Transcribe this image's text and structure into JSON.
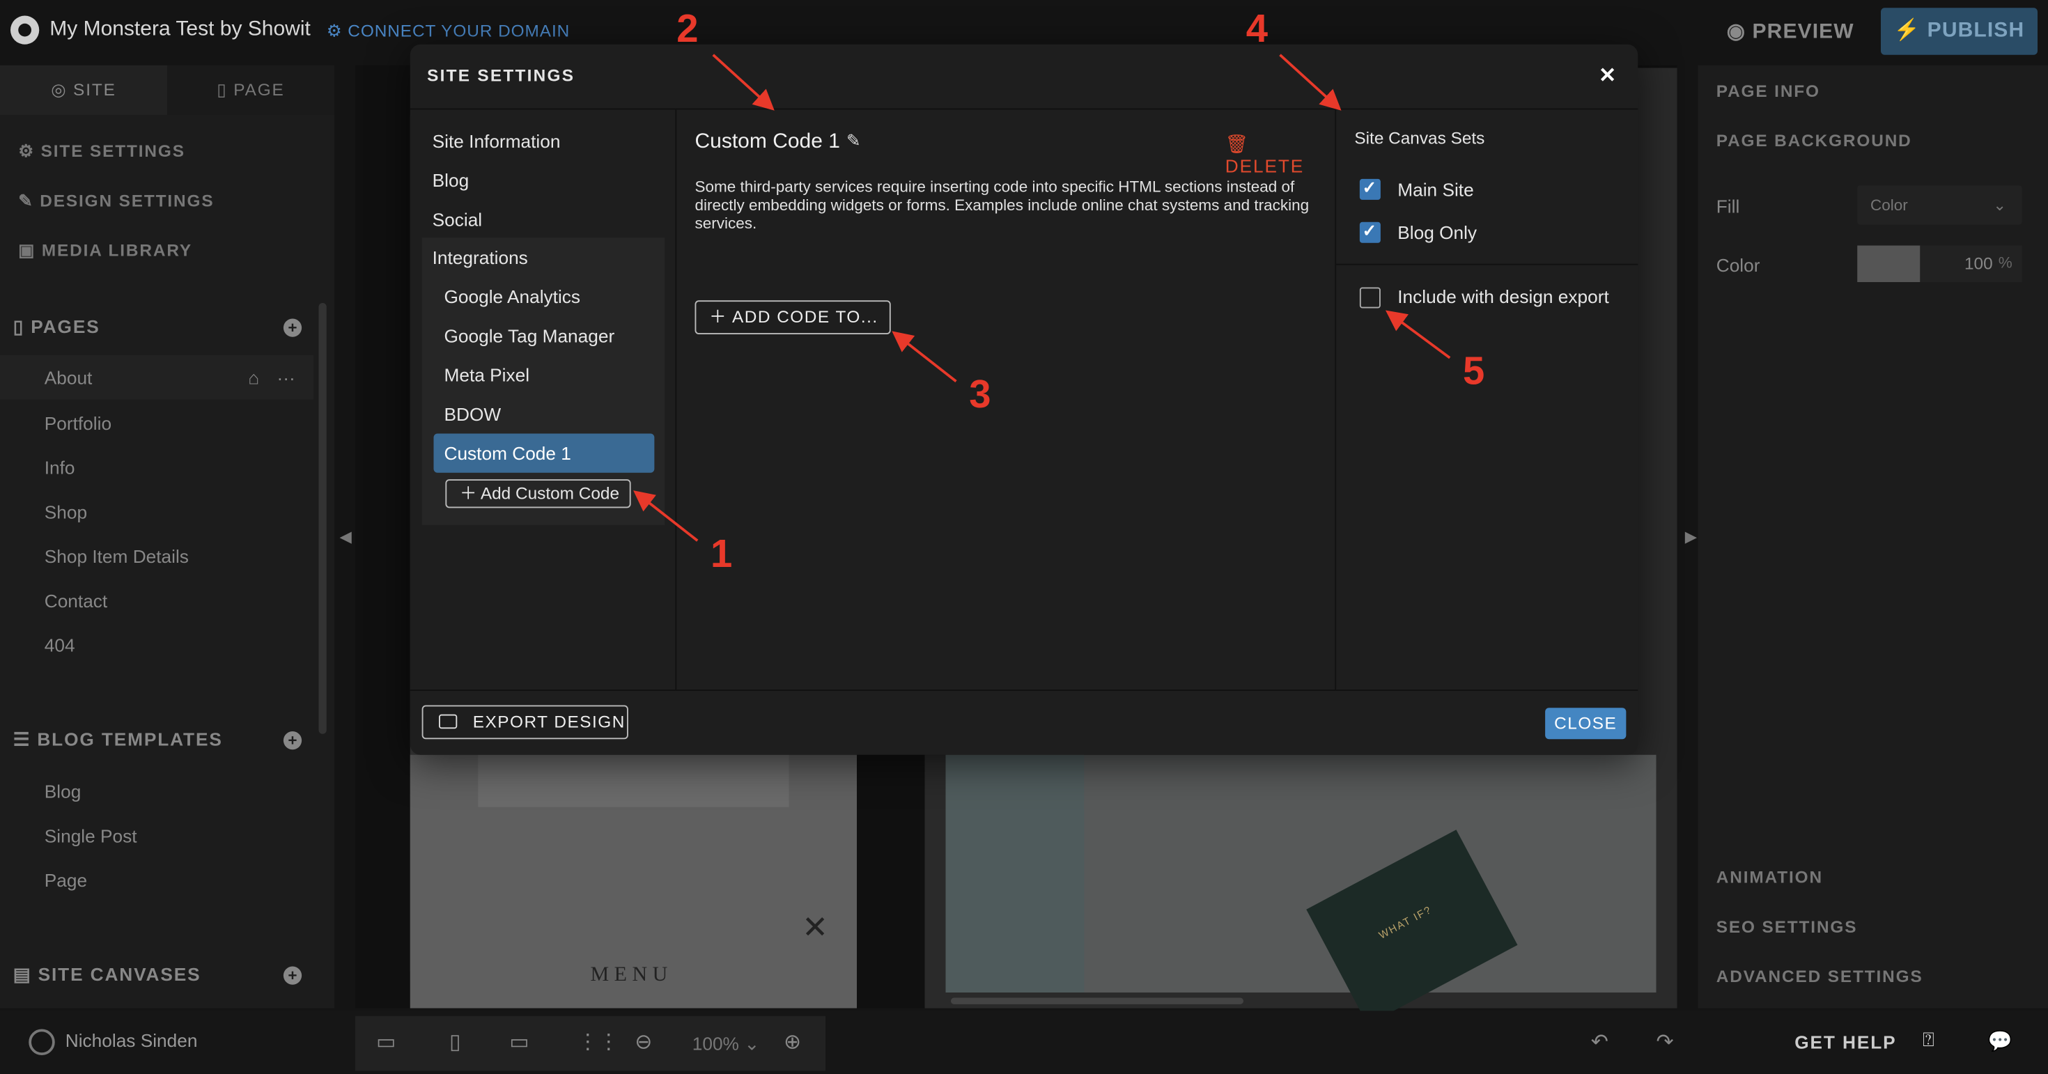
{
  "topbar": {
    "site_name": "My Monstera Test by Showit",
    "connect": "CONNECT YOUR DOMAIN",
    "preview": "PREVIEW",
    "publish": "PUBLISH"
  },
  "left_sidebar": {
    "tabs": [
      "SITE",
      "PAGE"
    ],
    "nav": [
      "SITE SETTINGS",
      "DESIGN SETTINGS",
      "MEDIA LIBRARY"
    ],
    "pages_header": "PAGES",
    "pages": [
      "About",
      "Portfolio",
      "Info",
      "Shop",
      "Shop Item Details",
      "Contact",
      "404"
    ],
    "blog_header": "BLOG TEMPLATES",
    "blog_items": [
      "Blog",
      "Single Post",
      "Page"
    ],
    "canvases_header": "SITE CANVASES"
  },
  "bottombar": {
    "user": "Nicholas Sinden",
    "zoom": "100%",
    "get_help": "GET HELP"
  },
  "canvas": {
    "menu_text": "MENU",
    "note_text": "WHAT IF?"
  },
  "right_sidebar": {
    "page_info": "PAGE INFO",
    "page_background": "PAGE BACKGROUND",
    "fill_label": "Fill",
    "fill_value": "Color",
    "color_label": "Color",
    "color_opacity": "100",
    "color_pct": "%",
    "animation": "ANIMATION",
    "seo": "SEO SETTINGS",
    "advanced": "ADVANCED SETTINGS"
  },
  "modal": {
    "title": "SITE SETTINGS",
    "nav": [
      "Site Information",
      "Blog",
      "Social"
    ],
    "integrations_label": "Integrations",
    "integrations": [
      "Google Analytics",
      "Google Tag Manager",
      "Meta Pixel",
      "BDOW"
    ],
    "active_item": "Custom Code 1",
    "add_custom_code": "Add Custom Code",
    "main_title": "Custom Code 1",
    "delete": "DELETE",
    "description": "Some third-party services require inserting code into specific HTML sections instead of directly embedding widgets or forms. Examples include online chat systems and tracking services.",
    "add_code_to": "ADD CODE TO...",
    "right_header": "Site Canvas Sets",
    "checkboxes": [
      {
        "label": "Main Site",
        "checked": true
      },
      {
        "label": "Blog Only",
        "checked": true
      }
    ],
    "include_export": {
      "label": "Include with design export",
      "checked": false
    },
    "export_design": "EXPORT DESIGN",
    "close": "CLOSE"
  },
  "annotations": [
    "1",
    "2",
    "3",
    "4",
    "5"
  ],
  "colors": {
    "accent_blue": "#3a6a94",
    "close_button": "#4486c2",
    "delete_red": "#e24a2d",
    "annotation_red": "#e8392a"
  }
}
